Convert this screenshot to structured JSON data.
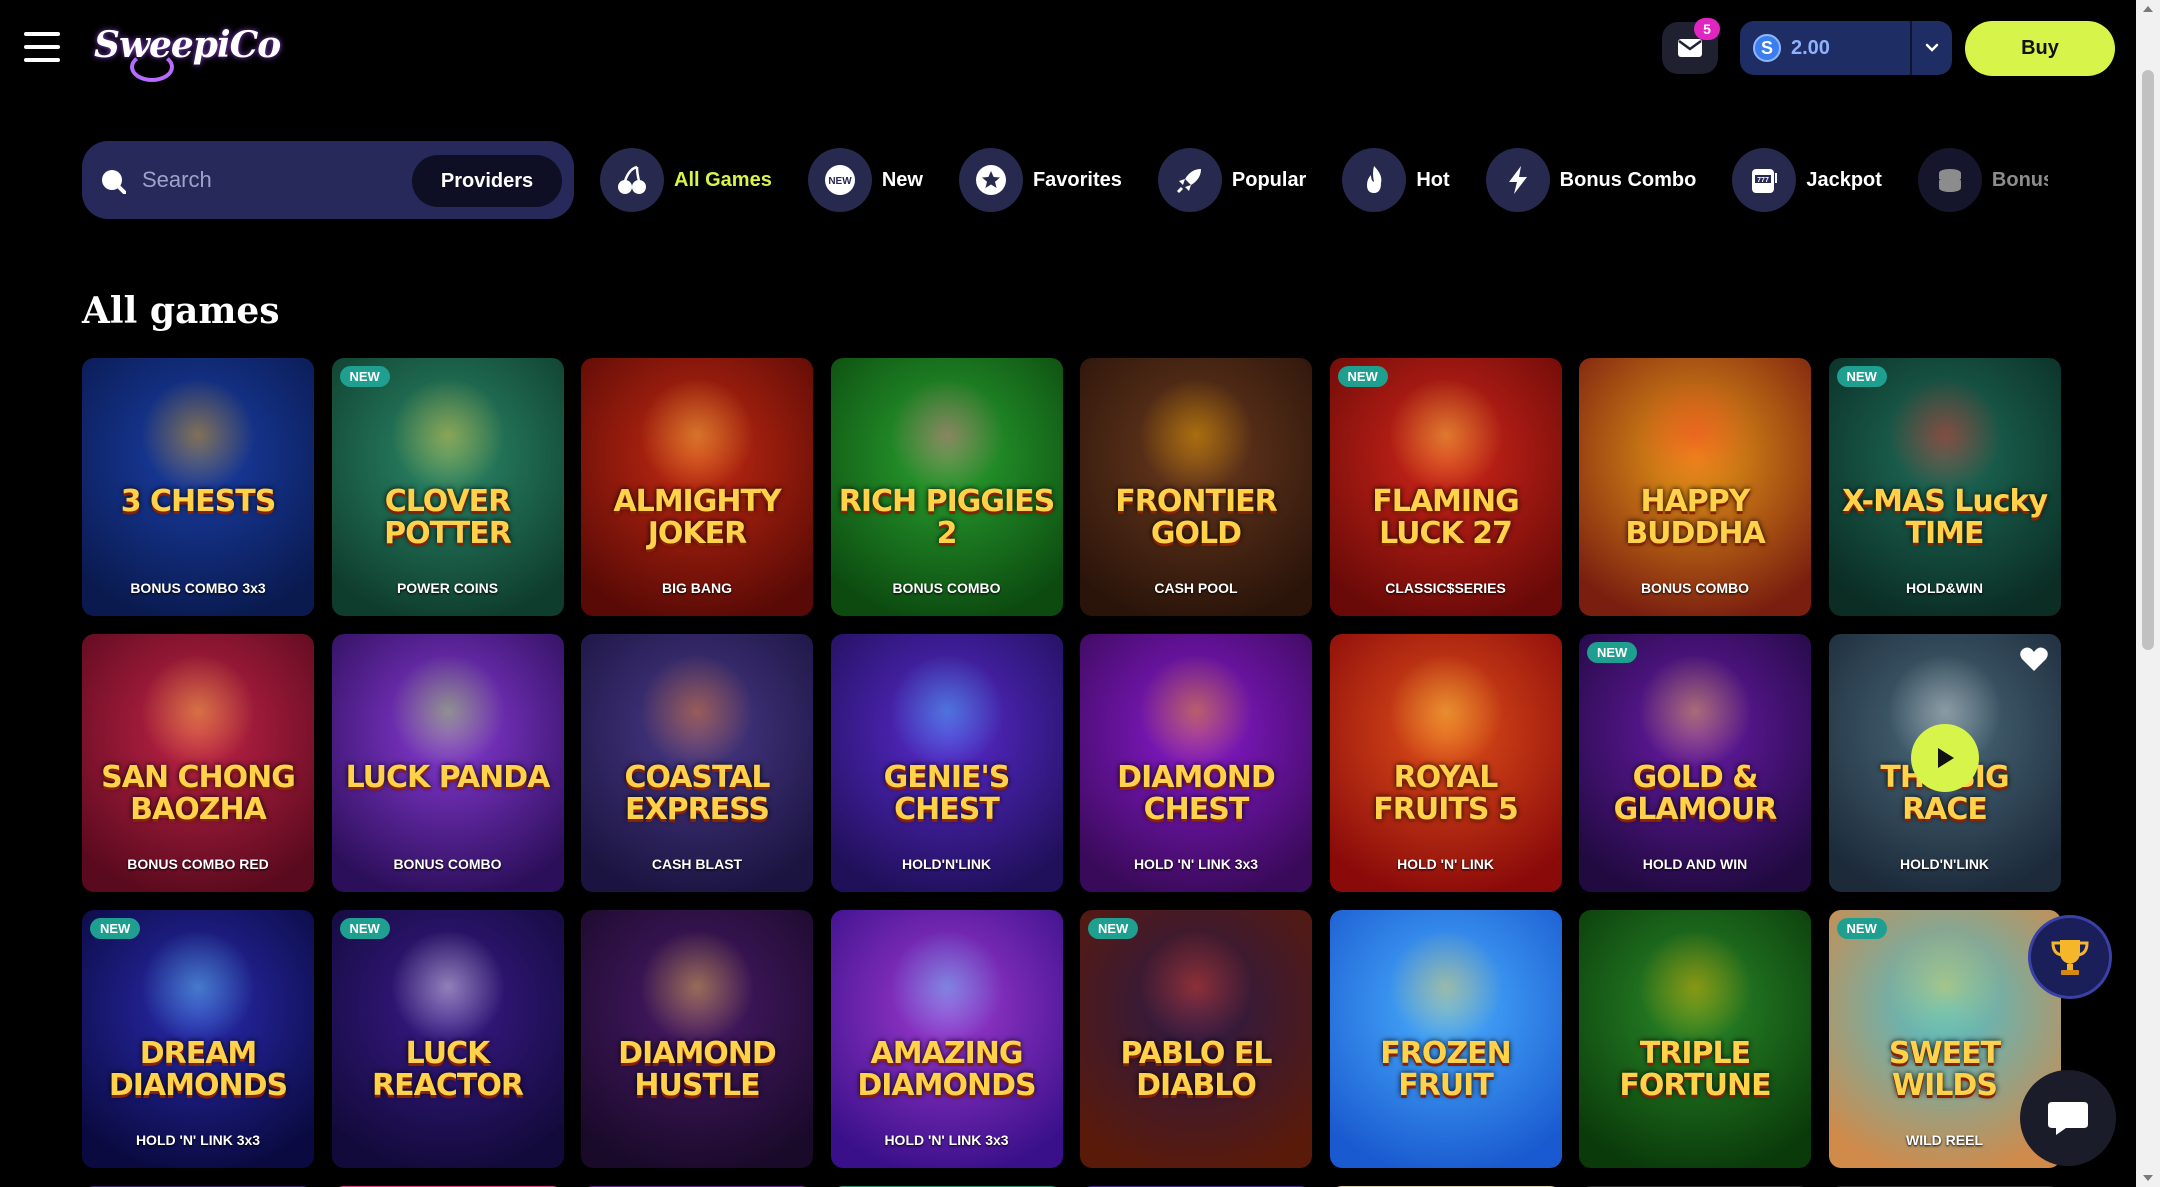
{
  "header": {
    "logo_text": "SweepiCo",
    "mail_badge": "5",
    "balance": "2.00",
    "coin_symbol": "S",
    "buy_label": "Buy"
  },
  "search": {
    "placeholder": "Search",
    "providers_label": "Providers"
  },
  "categories": [
    {
      "label": "All Games",
      "icon": "cherries-icon",
      "active": true
    },
    {
      "label": "New",
      "icon": "new-badge-icon"
    },
    {
      "label": "Favorites",
      "icon": "star-icon"
    },
    {
      "label": "Popular",
      "icon": "rocket-icon"
    },
    {
      "label": "Hot",
      "icon": "flame-icon"
    },
    {
      "label": "Bonus Combo",
      "icon": "lightning-icon"
    },
    {
      "label": "Jackpot",
      "icon": "slot-machine-icon"
    },
    {
      "label": "Bonus Buy",
      "icon": "coin-stack-icon"
    }
  ],
  "section_title": "All games",
  "new_badge_label": "NEW",
  "games": [
    {
      "name": "3 CHESTS",
      "sub": "BONUS COMBO 3x3",
      "new": false,
      "bg": [
        "#1a3fa8",
        "#0a1a4f"
      ],
      "accent": "#ffb300"
    },
    {
      "name": "CLOVER POTTER",
      "sub": "POWER COINS",
      "new": true,
      "bg": [
        "#2b8a6a",
        "#0f3d2d"
      ],
      "accent": "#ffd24a"
    },
    {
      "name": "ALMIGHTY JOKER",
      "sub": "BIG BANG",
      "new": false,
      "bg": [
        "#c42a12",
        "#5a0a06"
      ],
      "accent": "#ffd24a"
    },
    {
      "name": "RICH PIGGIES 2",
      "sub": "BONUS COMBO",
      "new": false,
      "bg": [
        "#2aa430",
        "#0c4a10"
      ],
      "accent": "#ff6fa0"
    },
    {
      "name": "FRONTIER GOLD",
      "sub": "CASH POOL",
      "new": false,
      "bg": [
        "#6b3a1e",
        "#2a140a"
      ],
      "accent": "#ffb300"
    },
    {
      "name": "FLAMING LUCK 27",
      "sub": "CLASSIC$SERIES",
      "new": true,
      "bg": [
        "#d2261a",
        "#6a0a08"
      ],
      "accent": "#ffe14a"
    },
    {
      "name": "HAPPY BUDDHA",
      "sub": "BONUS COMBO",
      "new": false,
      "bg": [
        "#e79a17",
        "#7a1e10"
      ],
      "accent": "#ff3a2a"
    },
    {
      "name": "X-MAS Lucky TIME",
      "sub": "HOLD&WIN",
      "new": true,
      "bg": [
        "#1e6e5a",
        "#0b2d24"
      ],
      "accent": "#ff2d2d"
    },
    {
      "name": "SAN CHONG BAOZHA",
      "sub": "BONUS COMBO RED",
      "new": false,
      "bg": [
        "#c22348",
        "#5a0a1e"
      ],
      "accent": "#ffd24a"
    },
    {
      "name": "LUCK PANDA",
      "sub": "BONUS COMBO",
      "new": false,
      "bg": [
        "#8a3ad8",
        "#2c0f5a"
      ],
      "accent": "#a6ff4a"
    },
    {
      "name": "COASTAL EXPRESS",
      "sub": "CASH BLAST",
      "new": false,
      "bg": [
        "#4a3a8a",
        "#1b1440"
      ],
      "accent": "#ff8a2a"
    },
    {
      "name": "GENIE'S CHEST",
      "sub": "HOLD'N'LINK",
      "new": false,
      "bg": [
        "#5a2ad0",
        "#20105a"
      ],
      "accent": "#4ad0ff"
    },
    {
      "name": "DIAMOND CHEST",
      "sub": "HOLD 'N' LINK 3x3",
      "new": false,
      "bg": [
        "#8a1ad0",
        "#3a0a5a"
      ],
      "accent": "#ffb300"
    },
    {
      "name": "ROYAL FRUITS 5",
      "sub": "HOLD 'N' LINK",
      "new": false,
      "bg": [
        "#e0501a",
        "#8a0a0a"
      ],
      "accent": "#ffe14a"
    },
    {
      "name": "GOLD & GLAMOUR",
      "sub": "HOLD AND WIN",
      "new": true,
      "bg": [
        "#6a1aa8",
        "#200a40"
      ],
      "accent": "#ffd24a"
    },
    {
      "name": "THE BIG RACE",
      "sub": "HOLD'N'LINK",
      "new": false,
      "bg": [
        "#4a6a7a",
        "#1c2a3a"
      ],
      "accent": "#e0e0e0"
    },
    {
      "name": "DREAM DIAMONDS",
      "sub": "HOLD 'N' LINK 3x3",
      "new": true,
      "bg": [
        "#2a2ab0",
        "#0a0a40"
      ],
      "accent": "#6ae0ff"
    },
    {
      "name": "LUCK REACTOR",
      "sub": "",
      "new": true,
      "bg": [
        "#3a1a8a",
        "#120a3a"
      ],
      "accent": "#ffffff"
    },
    {
      "name": "DIAMOND HUSTLE",
      "sub": "",
      "new": false,
      "bg": [
        "#4a1a6a",
        "#1a0a2a"
      ],
      "accent": "#ffd24a"
    },
    {
      "name": "AMAZING DIAMONDS",
      "sub": "HOLD 'N' LINK 3x3",
      "new": false,
      "bg": [
        "#a03ad0",
        "#3a108a"
      ],
      "accent": "#6ae0ff"
    },
    {
      "name": "PABLO EL DIABLO",
      "sub": "",
      "new": true,
      "bg": [
        "#2a1a4a",
        "#5a1a0a"
      ],
      "accent": "#ff4a2a"
    },
    {
      "name": "FROZEN FRUIT",
      "sub": "",
      "new": false,
      "bg": [
        "#4ab0ff",
        "#1a5ad0"
      ],
      "accent": "#ffd24a"
    },
    {
      "name": "TRIPLE FORTUNE",
      "sub": "",
      "new": false,
      "bg": [
        "#2a8a2a",
        "#0a3a0a"
      ],
      "accent": "#ffb300"
    },
    {
      "name": "SWEET WILDS",
      "sub": "WILD REEL",
      "new": true,
      "bg": [
        "#4ac0d0",
        "#d08a4a"
      ],
      "accent": "#ffd24a"
    }
  ],
  "partial_row_colors": [
    "#3a2a6a",
    "#e04a8a",
    "#6a2a8a",
    "#2a8a6a",
    "#4a2a8a",
    "#e0d0a0",
    "#2a2a2a",
    "#2a2a2a"
  ]
}
